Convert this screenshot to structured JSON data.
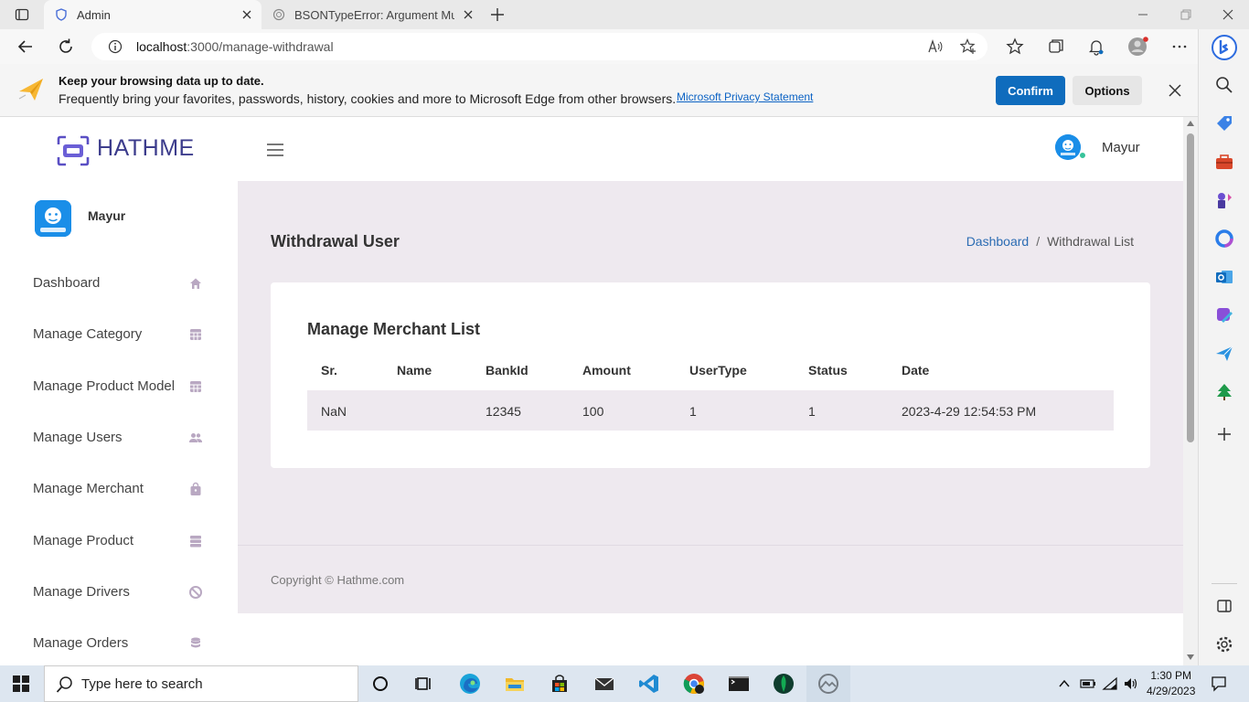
{
  "browser": {
    "tabs": [
      {
        "title": "Admin",
        "active": true
      },
      {
        "title": "BSONTypeError: Argument Must",
        "active": false
      }
    ],
    "address": {
      "host": "localhost",
      "path": ":3000/manage-withdrawal"
    }
  },
  "infobar": {
    "heading": "Keep your browsing data up to date.",
    "message": "Frequently bring your favorites, passwords, history, cookies and more to Microsoft Edge from other browsers.",
    "link": "Microsoft Privacy Statement",
    "confirm_label": "Confirm",
    "options_label": "Options"
  },
  "site": {
    "brand": "HATHME",
    "header_user": "Mayur",
    "sidebar_user": "Mayur",
    "nav": [
      {
        "label": "Dashboard",
        "icon": "home-icon"
      },
      {
        "label": "Manage Category",
        "icon": "grid-icon"
      },
      {
        "label": "Manage Product Model",
        "icon": "grid-icon"
      },
      {
        "label": "Manage Users",
        "icon": "users-icon"
      },
      {
        "label": "Manage Merchant",
        "icon": "bag-icon"
      },
      {
        "label": "Manage Product",
        "icon": "server-icon"
      },
      {
        "label": "Manage Drivers",
        "icon": "ban-icon"
      },
      {
        "label": "Manage Orders",
        "icon": "database-icon"
      }
    ]
  },
  "content": {
    "page_title": "Withdrawal User",
    "breadcrumb": {
      "home": "Dashboard",
      "current": "Withdrawal List",
      "separator": "/"
    },
    "card_title": "Manage Merchant List",
    "table": {
      "columns": [
        "Sr.",
        "Name",
        "BankId",
        "Amount",
        "UserType",
        "Status",
        "Date"
      ],
      "rows": [
        [
          "NaN",
          "",
          "12345",
          "100",
          "1",
          "1",
          "2023-4-29 12:54:53 PM"
        ]
      ]
    },
    "copyright": "Copyright © Hathme.com"
  },
  "taskbar": {
    "search_placeholder": "Type here to search",
    "time": "1:30 PM",
    "date": "4/29/2023"
  },
  "colors": {
    "brand": "#3c3c8c",
    "content_bg": "#eee9ef",
    "confirm_bg": "#0f6cbd",
    "link": "#2b6cb3"
  }
}
